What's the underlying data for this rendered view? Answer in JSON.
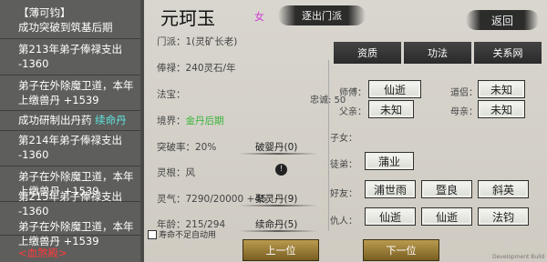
{
  "event_log": {
    "lines": [
      {
        "text": "【薄可钧】",
        "color": "white"
      },
      {
        "text": "成功突破到筑基后期",
        "color": "white"
      },
      {
        "text": "第213年弟子俸禄支出",
        "color": "white"
      },
      {
        "text": "-1360",
        "color": "white"
      },
      {
        "text": "弟子在外除魔卫道，本年",
        "color": "white"
      },
      {
        "text": "上缴兽丹 +1539",
        "color": "white"
      },
      {
        "text": "成功研制出丹药",
        "color": "white",
        "suffix": "续命丹"
      },
      {
        "text": "第214年弟子俸禄支出",
        "color": "white"
      },
      {
        "text": "-1360",
        "color": "white"
      },
      {
        "text": "弟子在外除魔卫道，本年",
        "color": "white"
      },
      {
        "text": "上缴兽丹 +1539",
        "color": "white"
      },
      {
        "text": "第215年弟子俸禄支出",
        "color": "white"
      },
      {
        "text": "-1360",
        "color": "white"
      },
      {
        "text": "弟子在外除魔卫道，本年",
        "color": "white"
      },
      {
        "text": "上缴兽丹 +1539",
        "color": "white"
      },
      {
        "text": "<血煞殿>",
        "color": "red"
      }
    ]
  },
  "character": {
    "name": "元珂玉",
    "gender": "女",
    "expel_button": "逐出门派",
    "back_button": "返回",
    "sect_line": "门派：1(灵矿长老)",
    "salary_line": "俸禄：240灵石/年",
    "treasure_label": "法宝：",
    "realm_label": "境界：",
    "realm_value": "金丹后期",
    "breakthrough_line": "突破率：20%",
    "breakthrough_pill": "破婴丹(0)",
    "root_line": "灵根：风",
    "spirit_line": "灵气：7290/20000 +45",
    "spirit_pill": "聚灵丹(9)",
    "age_line": "年龄：215/294",
    "age_pill": "续命丹(5)",
    "auto_use_label": "寿命不足自动用"
  },
  "tabs": [
    "资质",
    "功法",
    "关系网"
  ],
  "relations": {
    "loyalty_label": "忠诚: 50",
    "master_label": "师傅：",
    "master_value": "仙逝",
    "dao_partner_label": "道侣：",
    "dao_partner_value": "未知",
    "father_label": "父亲：",
    "father_value": "未知",
    "mother_label": "母亲：",
    "mother_value": "未知",
    "children_label": "子女：",
    "disciples_label": "徒弟：",
    "disciples": [
      "蒲业"
    ],
    "friends_label": "好友：",
    "friends": [
      "浦世雨",
      "暨良",
      "斜英"
    ],
    "enemies_label": "仇人：",
    "enemies": [
      "仙逝",
      "仙逝",
      "法钧"
    ]
  },
  "nav": {
    "prev_label": "上一位",
    "next_label": "下一位"
  },
  "watermark": "Development Build",
  "colors": {
    "log_bg": "#5e5e5c",
    "cyan": "#5fe6df",
    "red": "#ff3b3b",
    "green": "#3ab43a",
    "gold_button": "#9c7d38"
  }
}
